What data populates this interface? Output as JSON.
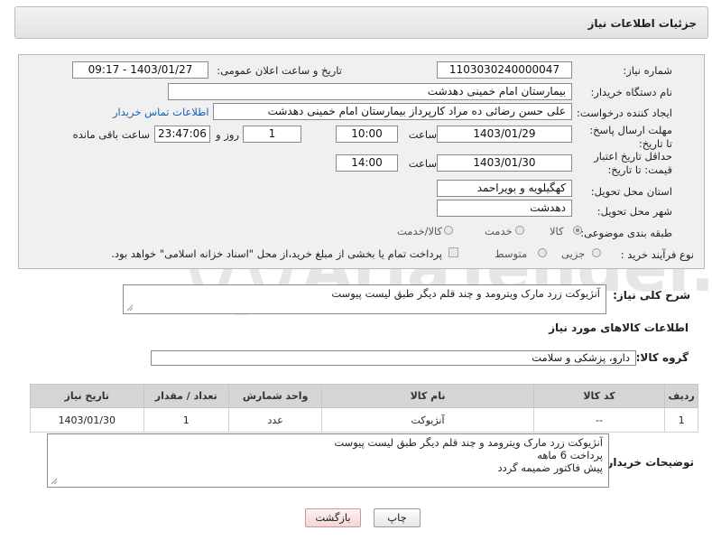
{
  "header": {
    "title": "جزئیات اطلاعات نیاز"
  },
  "form": {
    "need_number_label": "شماره نیاز:",
    "need_number": "1103030240000047",
    "announce_label": "تاریخ و ساعت اعلان عمومی:",
    "announce_value": "1403/01/27 - 09:17",
    "buyer_org_label": "نام دستگاه خریدار:",
    "buyer_org": "بیمارستان امام خمینی دهدشت",
    "creator_label": "ایجاد کننده درخواست:",
    "creator": "علی حسن رضائی ده مراد کارپرداز بیمارستان امام خمینی دهدشت",
    "contact_link": "اطلاعات تماس خریدار",
    "deadline_label": "مهلت ارسال پاسخ: تا تاریخ:",
    "deadline_date": "1403/01/29",
    "time_label": "ساعت",
    "deadline_time": "10:00",
    "day_count": "1",
    "day_and_label": "روز و",
    "remaining_time": "23:47:06",
    "remaining_label": "ساعت باقی مانده",
    "validity_label": "حداقل تاریخ اعتبار قیمت: تا تاریخ:",
    "validity_date": "1403/01/30",
    "validity_time": "14:00",
    "province_label": "استان محل تحویل:",
    "province": "کهگیلویه و بویراحمد",
    "city_label": "شهر محل تحویل:",
    "city": "دهدشت",
    "category_label": "طبقه بندی موضوعی:",
    "category_options": [
      "کالا",
      "خدمت",
      "کالا/خدمت"
    ],
    "category_selected": "کالا",
    "process_label": "نوع فرآیند خرید :",
    "process_options": [
      "جزیی",
      "متوسط"
    ],
    "process_note": "پرداخت تمام یا بخشی از مبلغ خرید،از محل \"اسناد خزانه اسلامی\" خواهد بود."
  },
  "summary": {
    "label": "شرح کلی نیاز:",
    "text": "آنژیوکت زرد مارک ویترومد و چند قلم دیگر طبق لیست پیوست"
  },
  "goods": {
    "section_title": "اطلاعات کالاهای مورد نیاز",
    "group_label": "گروه کالا:",
    "group_value": "دارو، پزشکی و سلامت",
    "columns": [
      "ردیف",
      "کد کالا",
      "نام کالا",
      "واحد شمارش",
      "تعداد / مقدار",
      "تاریخ نیاز"
    ],
    "rows": [
      {
        "row": "1",
        "code": "--",
        "name": "آنژیوکت",
        "unit": "عدد",
        "qty": "1",
        "date": "1403/01/30"
      }
    ]
  },
  "buyer_notes": {
    "label": "توضیحات خریدار:",
    "lines": [
      "آنژیوکت زرد مارک ویترومد و چند قلم دیگر طبق لیست پیوست",
      "پرداخت 6 ماهه",
      "پیش فاکتور ضمیمه گردد"
    ]
  },
  "buttons": {
    "print": "چاپ",
    "back": "بازگشت"
  },
  "watermark": {
    "text": "AriaTender.net"
  }
}
